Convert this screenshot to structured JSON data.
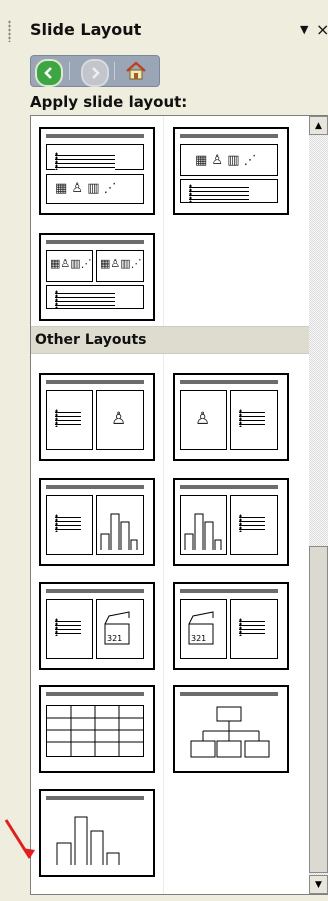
{
  "panel": {
    "title": "Slide Layout",
    "dropdown_icon": "▼",
    "close_icon": "×",
    "section_label": "Apply slide layout:",
    "other_layouts_label": "Other Layouts"
  },
  "nav": {
    "back_icon": "back-arrow-icon",
    "forward_icon": "forward-arrow-icon",
    "home_icon": "home-icon"
  },
  "colors": {
    "panel_bg": "#efedde",
    "header_band": "#dedbcf",
    "nav_bg": "#9aa6b6",
    "back_green": "#3ea543",
    "annotation_arrow": "#e02020"
  },
  "layouts": {
    "top": [
      "title-and-2-content-over-text",
      "title-text-and-content",
      "title-and-4-content"
    ],
    "other": [
      "title-text-and-clip-art",
      "title-clip-art-and-text",
      "title-text-and-chart",
      "title-chart-and-text",
      "title-text-and-media-clip",
      "title-media-clip-and-text",
      "title-and-table",
      "title-and-diagram",
      "title-and-chart"
    ]
  }
}
